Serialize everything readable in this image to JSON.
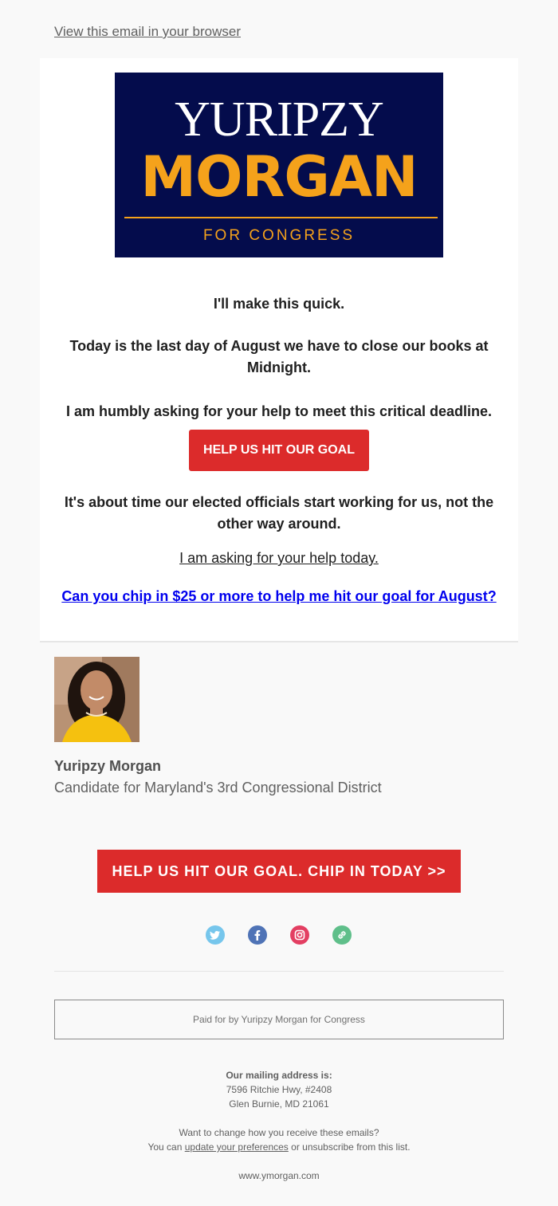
{
  "header": {
    "view_in_browser": "View this email in your browser"
  },
  "logo": {
    "first_name": "YURIPZY",
    "last_name": "MORGAN",
    "subtitle": "FOR CONGRESS"
  },
  "body": {
    "line1": "I'll make this quick.",
    "line2": "Today is the last day of August we have to close our books at Midnight.",
    "line3": "I am humbly asking for your help to meet this critical deadline.",
    "button_label": "HELP US HIT OUR GOAL",
    "line4": "It's about time our elected officials start working for us, not the other way around.",
    "link_today": "I am asking for your help today.",
    "link_chip_in": "Can you chip in $25 or more to help me hit our goal for August?"
  },
  "signature": {
    "name": "Yuripzy Morgan",
    "title": "Candidate for Maryland's 3rd Congressional District"
  },
  "cta": {
    "label": "HELP US HIT OUR GOAL. CHIP IN TODAY >>"
  },
  "social": [
    {
      "icon": "twitter-icon",
      "color": "#76c6ec"
    },
    {
      "icon": "facebook-icon",
      "color": "#4f73b6"
    },
    {
      "icon": "instagram-icon",
      "color": "#e33f62"
    },
    {
      "icon": "link-icon",
      "color": "#5fbf8a"
    }
  ],
  "footer": {
    "paid_for": "Paid for by Yuripzy Morgan for Congress",
    "mailing_heading": "Our mailing address is:",
    "address_line1": "7596 Ritchie Hwy, #2408",
    "address_line2": "Glen Burnie, MD 21061",
    "change_text": "Want to change how you receive these emails?",
    "you_can": "You can ",
    "update_prefs": "update your preferences",
    "or_unsubscribe": " or unsubscribe from this list.",
    "website": "www.ymorgan.com"
  },
  "colors": {
    "brand_navy": "#040c4c",
    "brand_orange": "#f5a21b",
    "cta_red": "#dc2b2b",
    "link_blue": "#0000ee"
  }
}
